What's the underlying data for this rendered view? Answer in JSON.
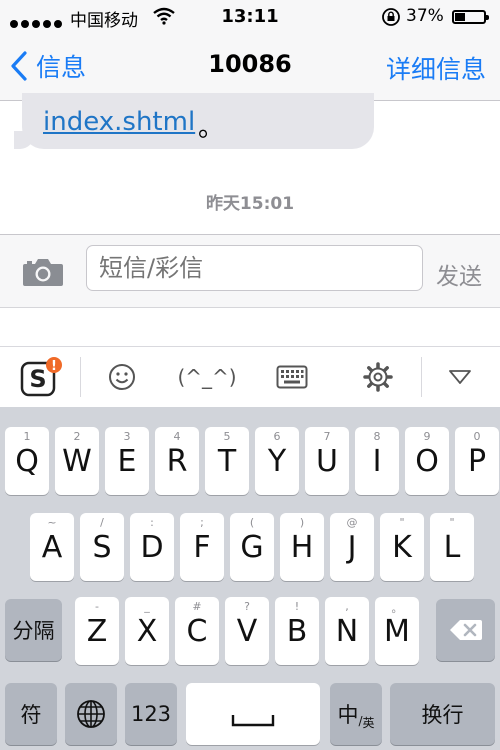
{
  "status_bar": {
    "carrier": "中国移动",
    "time": "13:11",
    "battery_percent": "37%",
    "battery_level": 0.37,
    "signal_icon": "signal-dots-icon",
    "wifi_icon": "wifi-icon",
    "lock_icon": "rotation-lock-icon"
  },
  "nav": {
    "back_label": "信息",
    "title": "10086",
    "details_label": "详细信息"
  },
  "messages": {
    "bubble_link": "index.shtml",
    "bubble_after": "。",
    "timestamp": "昨天15:01"
  },
  "compose": {
    "placeholder": "短信/彩信",
    "send_label": "发送"
  },
  "keyboard_toolbar": {
    "emoticon": "(^_^)",
    "icons": [
      "sogou-logo-icon",
      "smiley-icon",
      "keyboard-icon",
      "gear-icon",
      "collapse-triangle-icon"
    ]
  },
  "keyboard": {
    "row1": [
      {
        "hint": "1",
        "letter": "Q"
      },
      {
        "hint": "2",
        "letter": "W"
      },
      {
        "hint": "3",
        "letter": "E"
      },
      {
        "hint": "4",
        "letter": "R"
      },
      {
        "hint": "5",
        "letter": "T"
      },
      {
        "hint": "6",
        "letter": "Y"
      },
      {
        "hint": "7",
        "letter": "U"
      },
      {
        "hint": "8",
        "letter": "I"
      },
      {
        "hint": "9",
        "letter": "O"
      },
      {
        "hint": "0",
        "letter": "P"
      }
    ],
    "row2": [
      {
        "hint": "~",
        "letter": "A"
      },
      {
        "hint": "/",
        "letter": "S"
      },
      {
        "hint": ":",
        "letter": "D"
      },
      {
        "hint": ";",
        "letter": "F"
      },
      {
        "hint": "(",
        "letter": "G"
      },
      {
        "hint": ")",
        "letter": "H"
      },
      {
        "hint": "@",
        "letter": "J"
      },
      {
        "hint": "\"",
        "letter": "K"
      },
      {
        "hint": "\"",
        "letter": "L"
      }
    ],
    "row3": [
      {
        "hint": "-",
        "letter": "Z"
      },
      {
        "hint": "_",
        "letter": "X"
      },
      {
        "hint": "#",
        "letter": "C"
      },
      {
        "hint": "?",
        "letter": "V"
      },
      {
        "hint": "!",
        "letter": "B"
      },
      {
        "hint": ",",
        "letter": "N"
      },
      {
        "hint": "。",
        "letter": "M"
      }
    ],
    "shift_label": "分隔",
    "symbols_label": "符",
    "numbers_label": "123",
    "lang_label": "中",
    "lang_sub_label": "英",
    "return_label": "换行"
  }
}
